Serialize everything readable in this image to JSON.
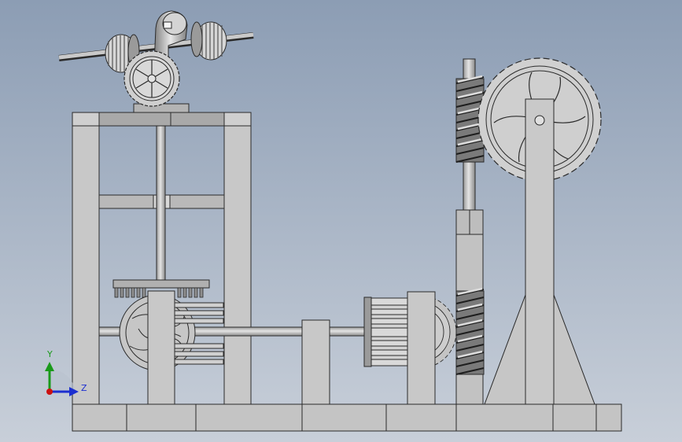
{
  "axes_triad": {
    "y_label": "Y",
    "z_label": "Z",
    "y_color": "#1a9a1a",
    "z_color": "#1c2fd0",
    "origin_color": "#cc1111"
  },
  "colors": {
    "background_top": "#8c9db4",
    "background_bottom": "#c8cfd9",
    "metal": "#c8c8c8",
    "metal_light": "#dedede",
    "metal_dark": "#8a8a8a",
    "outline": "#2a2a2a"
  }
}
